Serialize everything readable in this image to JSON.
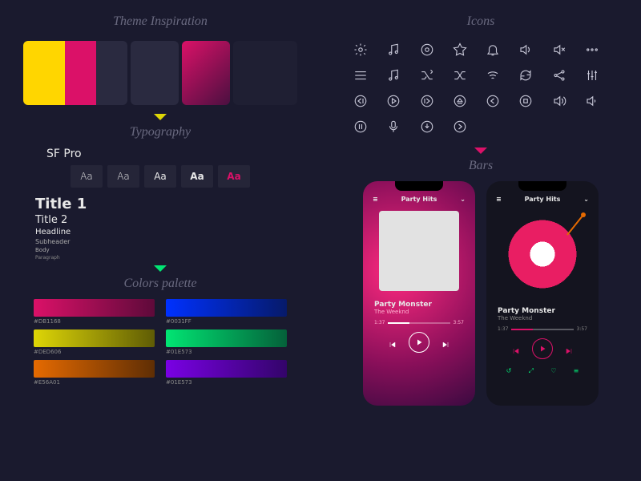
{
  "sections": {
    "inspiration": "Theme Inspiration",
    "typography": "Typography",
    "colors": "Colors palette",
    "icons": "Icons",
    "bars": "Bars"
  },
  "typography": {
    "family": "SF Pro",
    "weight_sample": "Aa",
    "scale": {
      "title1": "Title 1",
      "title2": "Title 2",
      "headline": "Headline",
      "subheader": "Subheader",
      "body": "Body",
      "paragraph": "Paragraph"
    }
  },
  "palette": [
    {
      "hex": "#DB1168",
      "grad": "linear-gradient(90deg,#db1168,#5e0a3a)"
    },
    {
      "hex": "#0031FF",
      "grad": "linear-gradient(90deg,#0031ff,#061a6a)"
    },
    {
      "hex": "#DED606",
      "grad": "linear-gradient(90deg,#ded606,#5f5c05)"
    },
    {
      "hex": "#01E573",
      "grad": "linear-gradient(90deg,#01e573,#04613a)"
    },
    {
      "hex": "#E56A01",
      "grad": "linear-gradient(90deg,#e56a01,#5f2e04)"
    },
    {
      "hex": "#01E573",
      "grad": "linear-gradient(90deg,#7a01e5,#33046a)"
    }
  ],
  "icons": [
    "settings",
    "note",
    "disc",
    "star",
    "bell",
    "volume",
    "mute",
    "more",
    "menu",
    "music",
    "shuffle",
    "shuffle-off",
    "wifi",
    "refresh",
    "share",
    "equalizer",
    "rewind",
    "play-circle",
    "skip",
    "eject",
    "prev-track",
    "stop",
    "vol-up",
    "vol-down",
    "pause",
    "mic",
    "download",
    "next-circle"
  ],
  "player": {
    "header": "Party Hits",
    "track": "Party Monster",
    "artist": "The Weeknd",
    "time_elapsed": "1:37",
    "time_total": "3:57"
  },
  "extra_icons": [
    "↺",
    "⤢",
    "♡",
    "≡"
  ]
}
